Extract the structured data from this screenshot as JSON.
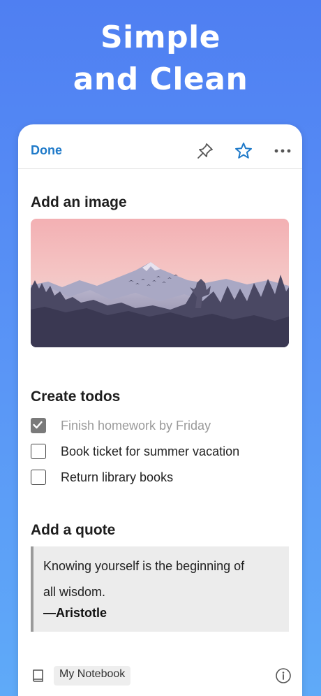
{
  "headline": {
    "line1": "Simple",
    "line2": "and Clean"
  },
  "toolbar": {
    "done_label": "Done",
    "icons": [
      "pin-icon",
      "star-icon",
      "more-icon"
    ]
  },
  "sections": {
    "image_title": "Add an image",
    "todos_title": "Create todos",
    "quote_title": "Add a quote"
  },
  "todos": [
    {
      "text": "Finish homework by Friday",
      "checked": true
    },
    {
      "text": "Book ticket for summer vacation",
      "checked": false
    },
    {
      "text": "Return library books",
      "checked": false
    }
  ],
  "quote": {
    "line1": "Knowing yourself is the beginning of",
    "line2": "all wisdom.",
    "author": "—Aristotle"
  },
  "footer": {
    "notebook": "My Notebook"
  },
  "colors": {
    "accent": "#1f7ac9",
    "background_top": "#4f7ff2",
    "background_bottom": "#5faaf8"
  }
}
